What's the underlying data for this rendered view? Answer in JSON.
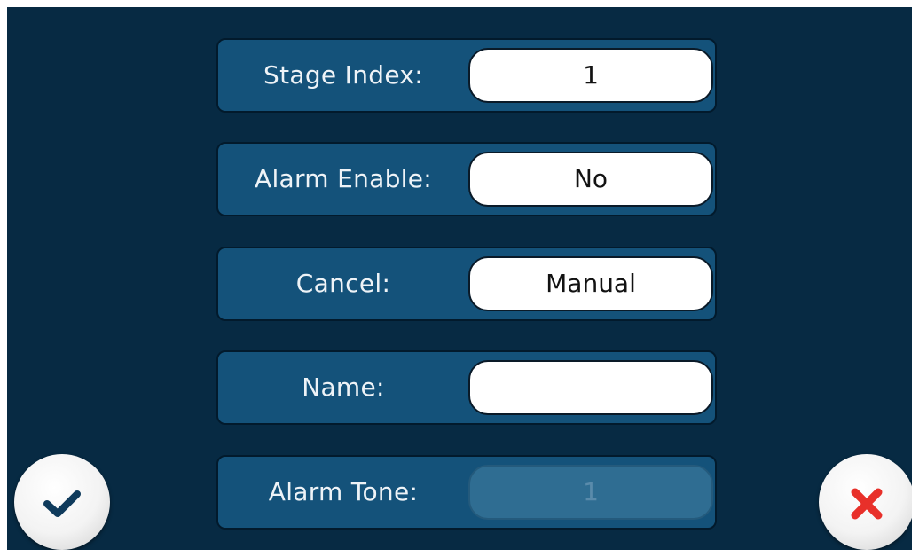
{
  "form": {
    "rows": [
      {
        "label": "Stage Index:",
        "value": "1",
        "state": "enabled"
      },
      {
        "label": "Alarm Enable:",
        "value": "No",
        "state": "enabled"
      },
      {
        "label": "Cancel:",
        "value": "Manual",
        "state": "enabled"
      },
      {
        "label": "Name:",
        "value": "",
        "state": "enabled"
      },
      {
        "label": "Alarm Tone:",
        "value": "1",
        "state": "disabled"
      }
    ]
  },
  "buttons": {
    "confirm": {
      "icon": "checkmark-icon",
      "color": "#0f3b5c"
    },
    "cancel": {
      "icon": "close-icon",
      "color": "#e8302a"
    }
  },
  "colors": {
    "background": "#072a43",
    "row": "#14527a",
    "field": "#ffffff",
    "disabled_field": "#2f6d92"
  }
}
